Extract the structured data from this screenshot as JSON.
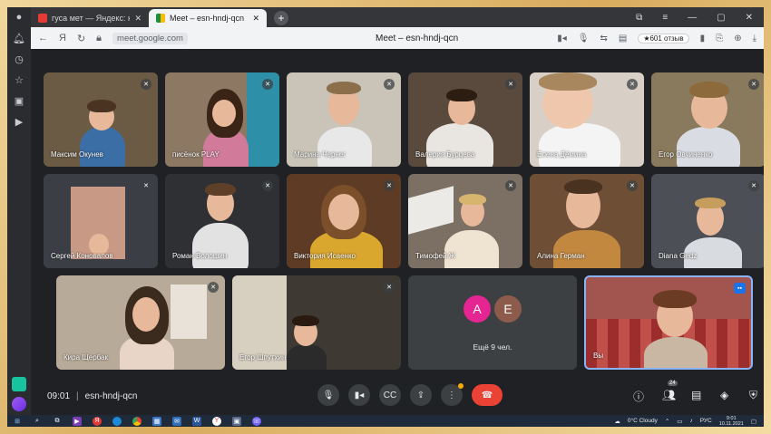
{
  "browser": {
    "tabs": [
      {
        "label": "гуса мет — Яндекс: нашл",
        "fav_color": "#e53935"
      },
      {
        "label": "Meet – esn-hndj-qcn",
        "fav_color": "#1e8e3e"
      }
    ],
    "address": {
      "back": "←",
      "ya": "Я",
      "reload": "↻",
      "url": "meet.google.com",
      "page_title": "Meet – esn-hndj-qcn",
      "reviews": "★601 отзыв"
    }
  },
  "tiles": [
    {
      "name": "Максим Окунев",
      "bg": "#6b5a44"
    },
    {
      "name": "писёнок PLAY",
      "bg": "#8d7864"
    },
    {
      "name": "Марина Чернег",
      "bg": "#c9c3b8"
    },
    {
      "name": "Валерия Бурцева",
      "bg": "#5a4a3e"
    },
    {
      "name": "Елена Дёмина",
      "bg": "#d8d0c6"
    },
    {
      "name": "Егор Овчиненко",
      "bg": "#8a7a5d"
    },
    {
      "name": "Сергей Коновалов",
      "bg": "#3b3e44"
    },
    {
      "name": "Роман Волошин",
      "bg": "#2e3034"
    },
    {
      "name": "Виктория Исаенко",
      "bg": "#5d3b24"
    },
    {
      "name": "Тимофей Ж",
      "bg": "#7c6f63"
    },
    {
      "name": "Алина Герман",
      "bg": "#6e4f36"
    },
    {
      "name": "Diana Gedz",
      "bg": "#4c4f55"
    },
    {
      "name": "Кира Щербак",
      "bg": "#b8aa98"
    },
    {
      "name": "Егор Шпутхин",
      "bg": "#3e3a33"
    },
    {
      "name": "Вы",
      "bg": "#a2544e"
    }
  ],
  "others": {
    "avatar_a": "A",
    "avatar_e": "E",
    "count_text": "Ещё 9 чел."
  },
  "controls": {
    "time": "09:01",
    "separator": "|",
    "meeting_code": "esn-hndj-qcn",
    "participants_count": "24"
  },
  "taskbar": {
    "weather": "0°C Cloudy",
    "lang": "РУС",
    "time": "9:01",
    "date": "10.11.2021"
  }
}
